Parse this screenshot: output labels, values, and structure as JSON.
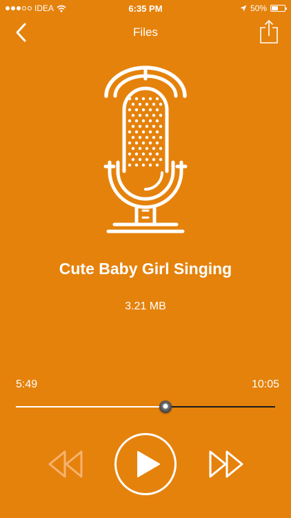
{
  "status_bar": {
    "carrier": "IDEA",
    "time": "6:35 PM",
    "battery_percent": "50%",
    "battery_level": 0.5,
    "icons": [
      "signal-dots-icon",
      "wifi-icon",
      "location-arrow-icon",
      "battery-icon"
    ]
  },
  "nav": {
    "title": "Files",
    "back_icon": "chevron-left-icon",
    "share_icon": "share-icon"
  },
  "track": {
    "title": "Cute Baby Girl Singing",
    "size": "3.21 MB",
    "icon": "microphone-icon"
  },
  "player": {
    "elapsed": "5:49",
    "total": "10:05",
    "progress": 0.577,
    "controls": [
      "rewind-icon",
      "play-icon",
      "fast-forward-icon"
    ]
  },
  "colors": {
    "background": "#e5820c",
    "foreground": "#ffffff",
    "progress_remaining": "#1a1a1a"
  }
}
